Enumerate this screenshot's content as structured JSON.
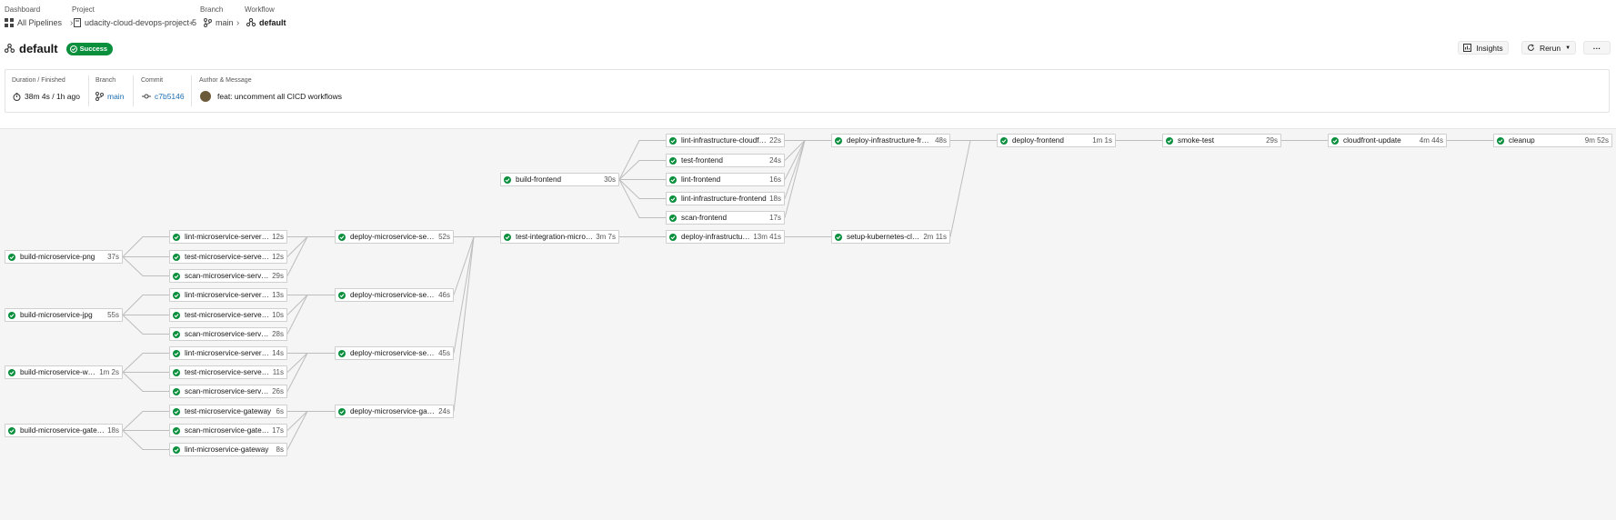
{
  "breadcrumb": {
    "dashboard": {
      "label": "Dashboard",
      "value": "All Pipelines"
    },
    "project": {
      "label": "Project",
      "value": "udacity-cloud-devops-project-5"
    },
    "branch": {
      "label": "Branch",
      "value": "main"
    },
    "workflow": {
      "label": "Workflow",
      "value": "default"
    }
  },
  "header": {
    "title": "default",
    "status": "Success",
    "insights_label": "Insights",
    "rerun_label": "Rerun",
    "more_label": "···"
  },
  "meta": {
    "duration_label": "Duration / Finished",
    "duration_value": "38m 4s / 1h ago",
    "branch_label": "Branch",
    "branch_value": "main",
    "commit_label": "Commit",
    "commit_value": "c7b5146",
    "author_label": "Author & Message",
    "message_value": "feat: uncomment all CICD workflows"
  },
  "colors": {
    "success": "#0a8f3d",
    "link": "#1d6fb5"
  },
  "jobs": [
    {
      "id": "png",
      "name": "build-microservice-png",
      "dur": "37s"
    },
    {
      "id": "jpg",
      "name": "build-microservice-jpg",
      "dur": "55s"
    },
    {
      "id": "webp",
      "name": "build-microservice-webp",
      "dur": "1m 2s"
    },
    {
      "id": "gw",
      "name": "build-microservice-gatew...",
      "dur": "18s"
    },
    {
      "id": "lpng",
      "name": "lint-microservice-server-p...",
      "dur": "12s"
    },
    {
      "id": "tpng",
      "name": "test-microservice-server-...",
      "dur": "12s"
    },
    {
      "id": "spng",
      "name": "scan-microservice-server-...",
      "dur": "29s"
    },
    {
      "id": "ljpg",
      "name": "lint-microservice-server-jpg",
      "dur": "13s"
    },
    {
      "id": "tjpg",
      "name": "test-microservice-server-j...",
      "dur": "10s"
    },
    {
      "id": "sjpg",
      "name": "scan-microservice-server-...",
      "dur": "28s"
    },
    {
      "id": "lwebp",
      "name": "lint-microservice-server-w...",
      "dur": "14s"
    },
    {
      "id": "twebp",
      "name": "test-microservice-server-...",
      "dur": "11s"
    },
    {
      "id": "swebp",
      "name": "scan-microservice-server-...",
      "dur": "26s"
    },
    {
      "id": "tgw",
      "name": "test-microservice-gateway",
      "dur": "6s"
    },
    {
      "id": "sgw",
      "name": "scan-microservice-gatew...",
      "dur": "17s"
    },
    {
      "id": "lgw",
      "name": "lint-microservice-gateway",
      "dur": "8s"
    },
    {
      "id": "dpng",
      "name": "deploy-microservice-serv...",
      "dur": "52s"
    },
    {
      "id": "djpg",
      "name": "deploy-microservice-serv...",
      "dur": "46s"
    },
    {
      "id": "dwebp",
      "name": "deploy-microservice-serv...",
      "dur": "45s"
    },
    {
      "id": "dgw",
      "name": "deploy-microservice-gate...",
      "dur": "24s"
    },
    {
      "id": "bfe",
      "name": "build-frontend",
      "dur": "30s"
    },
    {
      "id": "tint",
      "name": "test-integration-micros...",
      "dur": "3m 7s"
    },
    {
      "id": "licf",
      "name": "lint-infrastructure-cloudfr...",
      "dur": "22s"
    },
    {
      "id": "tfe",
      "name": "test-frontend",
      "dur": "24s"
    },
    {
      "id": "lfe",
      "name": "lint-frontend",
      "dur": "16s"
    },
    {
      "id": "life",
      "name": "lint-infrastructure-frontend",
      "dur": "18s"
    },
    {
      "id": "sfe",
      "name": "scan-frontend",
      "dur": "17s"
    },
    {
      "id": "dinf",
      "name": "deploy-infrastructur...",
      "dur": "13m 41s"
    },
    {
      "id": "dinfe",
      "name": "deploy-infrastructure-fron...",
      "dur": "48s"
    },
    {
      "id": "sk8s",
      "name": "setup-kubernetes-clu...",
      "dur": "2m 11s"
    },
    {
      "id": "dfe",
      "name": "deploy-frontend",
      "dur": "1m 1s"
    },
    {
      "id": "smoke",
      "name": "smoke-test",
      "dur": "29s"
    },
    {
      "id": "cfu",
      "name": "cloudfront-update",
      "dur": "4m 44s"
    },
    {
      "id": "clean",
      "name": "cleanup",
      "dur": "9m 52s"
    }
  ],
  "edges": [
    [
      "png",
      "lpng"
    ],
    [
      "png",
      "tpng"
    ],
    [
      "png",
      "spng"
    ],
    [
      "jpg",
      "ljpg"
    ],
    [
      "jpg",
      "tjpg"
    ],
    [
      "jpg",
      "sjpg"
    ],
    [
      "webp",
      "lwebp"
    ],
    [
      "webp",
      "twebp"
    ],
    [
      "webp",
      "swebp"
    ],
    [
      "gw",
      "tgw"
    ],
    [
      "gw",
      "sgw"
    ],
    [
      "gw",
      "lgw"
    ],
    [
      "lpng",
      "dpng"
    ],
    [
      "tpng",
      "dpng"
    ],
    [
      "spng",
      "dpng"
    ],
    [
      "ljpg",
      "djpg"
    ],
    [
      "tjpg",
      "djpg"
    ],
    [
      "sjpg",
      "djpg"
    ],
    [
      "lwebp",
      "dwebp"
    ],
    [
      "twebp",
      "dwebp"
    ],
    [
      "swebp",
      "dwebp"
    ],
    [
      "tgw",
      "dgw"
    ],
    [
      "sgw",
      "dgw"
    ],
    [
      "lgw",
      "dgw"
    ],
    [
      "dpng",
      "tint"
    ],
    [
      "djpg",
      "tint"
    ],
    [
      "dwebp",
      "tint"
    ],
    [
      "dgw",
      "tint"
    ],
    [
      "bfe",
      "licf"
    ],
    [
      "bfe",
      "tfe"
    ],
    [
      "bfe",
      "lfe"
    ],
    [
      "bfe",
      "life"
    ],
    [
      "bfe",
      "sfe"
    ],
    [
      "tint",
      "dinf"
    ],
    [
      "licf",
      "dinfe"
    ],
    [
      "tfe",
      "dinfe"
    ],
    [
      "lfe",
      "dinfe"
    ],
    [
      "life",
      "dinfe"
    ],
    [
      "sfe",
      "dinfe"
    ],
    [
      "dinf",
      "sk8s"
    ],
    [
      "dinfe",
      "dfe"
    ],
    [
      "sk8s",
      "dfe"
    ],
    [
      "dfe",
      "smoke"
    ],
    [
      "smoke",
      "cfu"
    ],
    [
      "cfu",
      "clean"
    ]
  ]
}
